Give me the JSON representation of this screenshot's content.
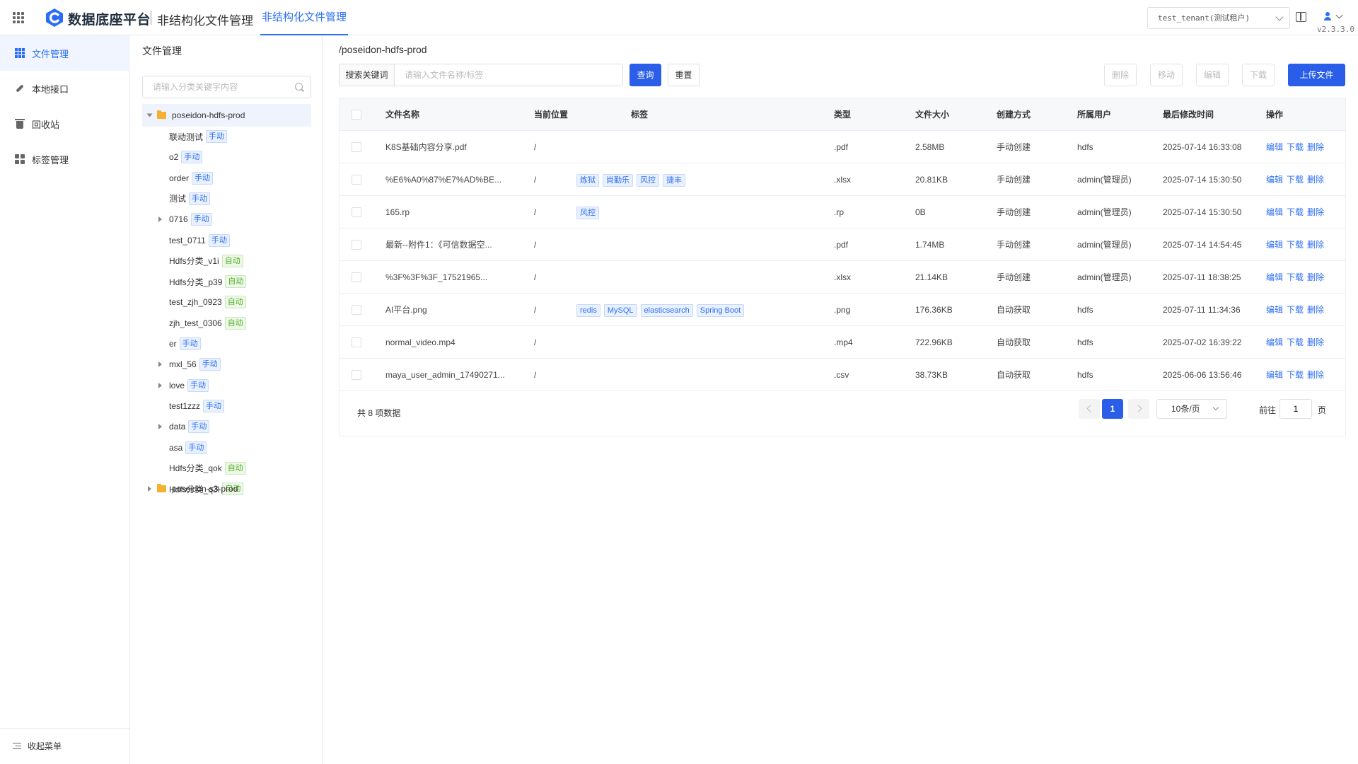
{
  "header": {
    "brand": "数据底座平台",
    "subsystem": "非结构化文件管理",
    "active_tab": "非结构化文件管理",
    "tenant": "test_tenant(测试租户)",
    "version": "v2.3.3.0",
    "accent_color": "#2b6ef5"
  },
  "nav": {
    "items": [
      {
        "label": "文件管理",
        "icon": "grid-icon",
        "active": true
      },
      {
        "label": "本地接口",
        "icon": "link-icon",
        "active": false
      },
      {
        "label": "回收站",
        "icon": "trash-icon",
        "active": false
      },
      {
        "label": "标签管理",
        "icon": "tags-icon",
        "active": false
      }
    ],
    "collapse_label": "收起菜单"
  },
  "tree": {
    "title": "文件管理",
    "search_placeholder": "请输入分类关键字内容",
    "roots": [
      {
        "label": "poseidon-hdfs-prod",
        "expanded": true
      },
      {
        "label": "poseidon-s3-prod",
        "expanded": false
      }
    ],
    "children": [
      {
        "label": "联动测试",
        "badge": "手动",
        "type": "manual",
        "has_children": false
      },
      {
        "label": "o2",
        "badge": "手动",
        "type": "manual",
        "has_children": false
      },
      {
        "label": "order",
        "badge": "手动",
        "type": "manual",
        "has_children": false
      },
      {
        "label": "测试",
        "badge": "手动",
        "type": "manual",
        "has_children": false
      },
      {
        "label": "0716",
        "badge": "手动",
        "type": "manual",
        "has_children": true
      },
      {
        "label": "test_0711",
        "badge": "手动",
        "type": "manual",
        "has_children": false
      },
      {
        "label": "Hdfs分类_v1i",
        "badge": "自动",
        "type": "auto",
        "has_children": false
      },
      {
        "label": "Hdfs分类_p39",
        "badge": "自动",
        "type": "auto",
        "has_children": false
      },
      {
        "label": "test_zjh_0923",
        "badge": "自动",
        "type": "auto",
        "has_children": false
      },
      {
        "label": "zjh_test_0306",
        "badge": "自动",
        "type": "auto",
        "has_children": false
      },
      {
        "label": "er",
        "badge": "手动",
        "type": "manual",
        "has_children": false
      },
      {
        "label": "mxl_56",
        "badge": "手动",
        "type": "manual",
        "has_children": true
      },
      {
        "label": "love",
        "badge": "手动",
        "type": "manual",
        "has_children": true
      },
      {
        "label": "test1zzz",
        "badge": "手动",
        "type": "manual",
        "has_children": false
      },
      {
        "label": "data",
        "badge": "手动",
        "type": "manual",
        "has_children": true
      },
      {
        "label": "asa",
        "badge": "手动",
        "type": "manual",
        "has_children": false
      },
      {
        "label": "Hdfs分类_qok",
        "badge": "自动",
        "type": "auto",
        "has_children": false
      },
      {
        "label": "Hdfs分类_q3l",
        "badge": "自动",
        "type": "auto",
        "has_children": true
      }
    ]
  },
  "main": {
    "path": "/poseidon-hdfs-prod",
    "search_label": "搜索关键词",
    "search_placeholder": "请输入文件名称/标签",
    "query_button": "查询",
    "reset_button": "重置",
    "actions": {
      "delete": "删除",
      "move": "移动",
      "edit": "编辑",
      "download": "下载",
      "upload": "上传文件"
    },
    "columns": [
      "文件名称",
      "当前位置",
      "标签",
      "类型",
      "文件大小",
      "创建方式",
      "所属用户",
      "最后修改时间",
      "操作"
    ],
    "rows": [
      {
        "name": "K8S基础内容分享.pdf",
        "location": "/",
        "tags": [],
        "type": ".pdf",
        "size": "2.58MB",
        "method": "手动创建",
        "user": "hdfs",
        "modified": "2025-07-14 16:33:08"
      },
      {
        "name": "%E6%A0%87%E7%AD%BE...",
        "location": "/",
        "tags": [
          "炼狱",
          "尚勤乐",
          "风控",
          "捷丰"
        ],
        "type": ".xlsx",
        "size": "20.81KB",
        "method": "手动创建",
        "user": "admin(管理员)",
        "modified": "2025-07-14 15:30:50"
      },
      {
        "name": "165.rp",
        "location": "/",
        "tags": [
          "风控"
        ],
        "type": ".rp",
        "size": "0B",
        "method": "手动创建",
        "user": "admin(管理员)",
        "modified": "2025-07-14 15:30:50"
      },
      {
        "name": "最新--附件1：《可信数据空...",
        "location": "/",
        "tags": [],
        "type": ".pdf",
        "size": "1.74MB",
        "method": "手动创建",
        "user": "admin(管理员)",
        "modified": "2025-07-14 14:54:45"
      },
      {
        "name": "%3F%3F%3F_17521965...",
        "location": "/",
        "tags": [],
        "type": ".xlsx",
        "size": "21.14KB",
        "method": "手动创建",
        "user": "admin(管理员)",
        "modified": "2025-07-11 18:38:25"
      },
      {
        "name": "AI平台.png",
        "location": "/",
        "tags": [
          "redis",
          "MySQL",
          "elasticsearch",
          "Spring Boot"
        ],
        "type": ".png",
        "size": "176.36KB",
        "method": "自动获取",
        "user": "hdfs",
        "modified": "2025-07-11 11:34:36"
      },
      {
        "name": "normal_video.mp4",
        "location": "/",
        "tags": [],
        "type": ".mp4",
        "size": "722.96KB",
        "method": "自动获取",
        "user": "hdfs",
        "modified": "2025-07-02 16:39:22"
      },
      {
        "name": "maya_user_admin_17490271...",
        "location": "/",
        "tags": [],
        "type": ".csv",
        "size": "38.73KB",
        "method": "自动获取",
        "user": "hdfs",
        "modified": "2025-06-06 13:56:46"
      }
    ],
    "row_ops": [
      "编辑",
      "下载",
      "删除"
    ],
    "pagination": {
      "total_text": "共 8 项数据",
      "current_page": "1",
      "page_size": "10条/页",
      "goto_label": "前往",
      "goto_value": "1",
      "goto_unit": "页"
    }
  }
}
